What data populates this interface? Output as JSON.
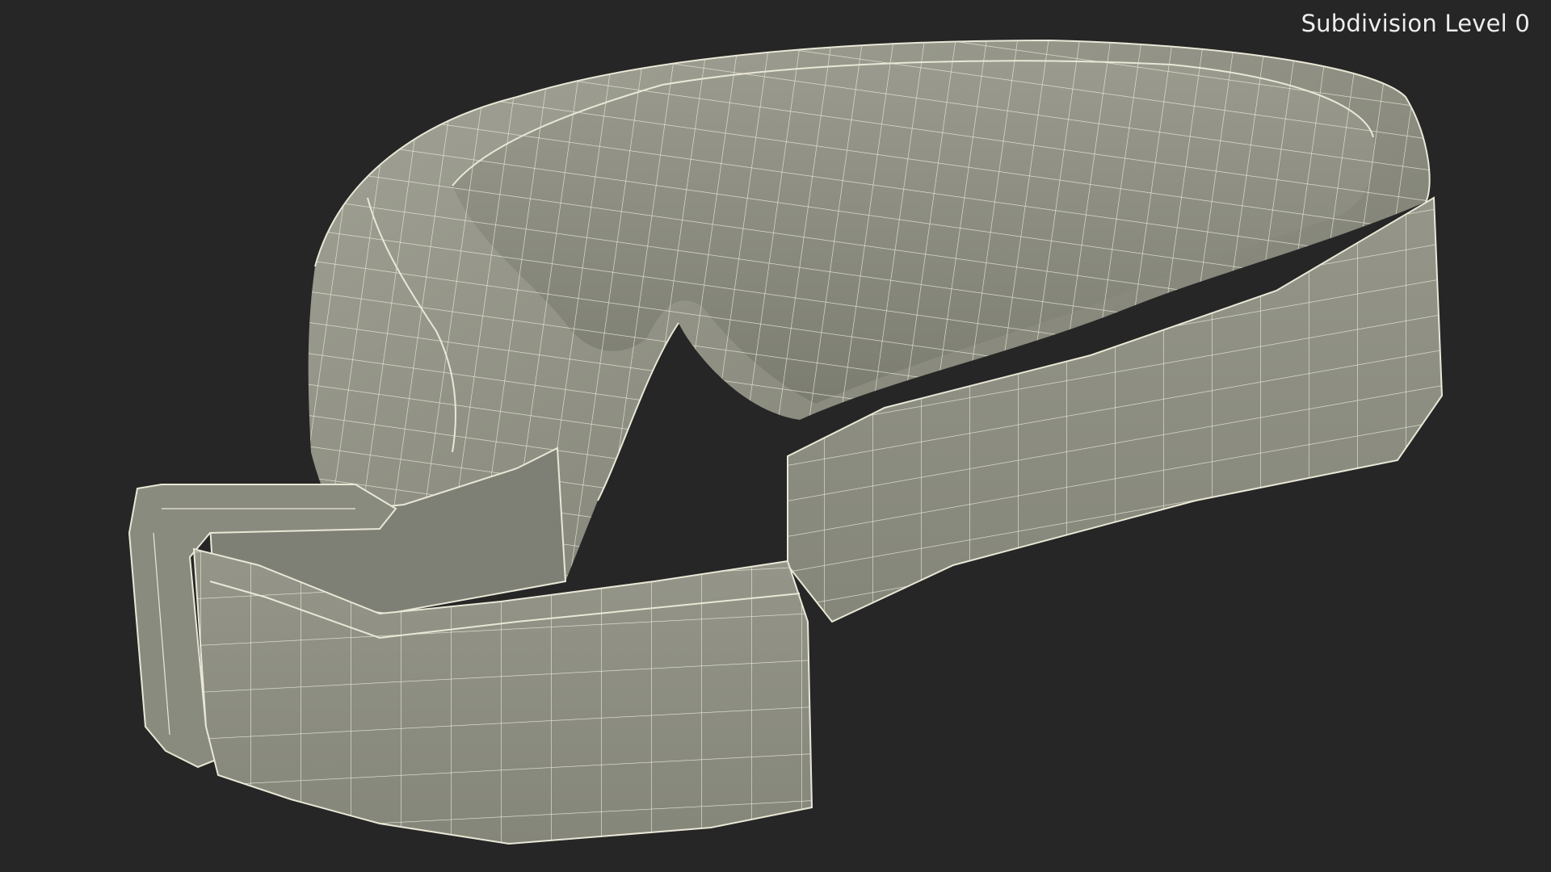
{
  "viewport": {
    "label": "Subdivision Level 0",
    "background_color": "#262626"
  },
  "model": {
    "surface_color": "#8c8d80",
    "shadow_color": "#6e6f64",
    "highlight_color": "#a2a396",
    "wire_color": "#f4f2e4"
  }
}
